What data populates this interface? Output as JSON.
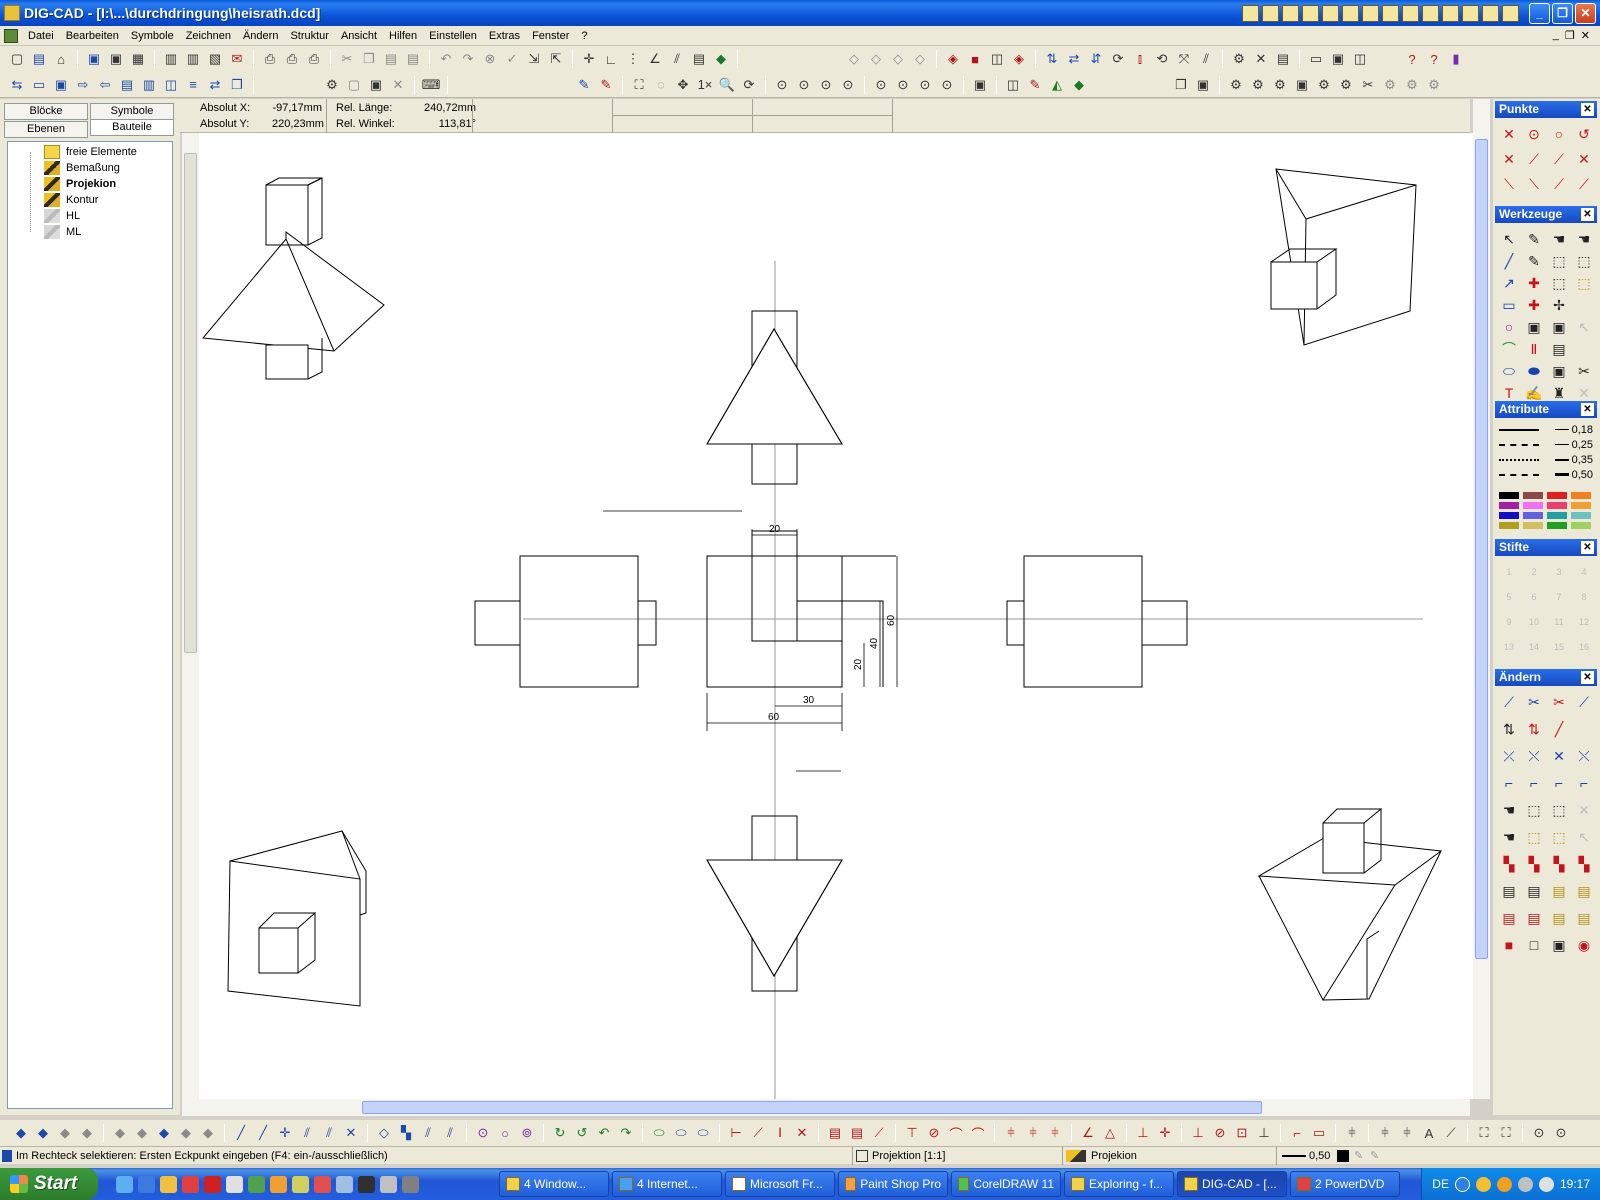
{
  "window": {
    "title": "DIG-CAD - [I:\\...\\durchdringung\\heisrath.dcd]"
  },
  "menu": [
    "Datei",
    "Bearbeiten",
    "Symbole",
    "Zeichnen",
    "Ändern",
    "Struktur",
    "Ansicht",
    "Hilfen",
    "Einstellen",
    "Extras",
    "Fenster",
    "?"
  ],
  "left_panel": {
    "tabs": [
      "Blöcke",
      "Symbole",
      "Ebenen",
      "Bauteile"
    ],
    "active_tab": "Bauteile",
    "tree": [
      {
        "label": "freie Elemente",
        "icon": "folder-icon"
      },
      {
        "label": "Bemaßung",
        "icon": "part-icon"
      },
      {
        "label": "Projekion",
        "icon": "part-icon",
        "bold": true
      },
      {
        "label": "Kontur",
        "icon": "part-icon"
      },
      {
        "label": "HL",
        "icon": "part-icon-gray"
      },
      {
        "label": "ML",
        "icon": "part-icon-gray"
      }
    ]
  },
  "coords": {
    "abs_x_label": "Absolut X:",
    "abs_x": "-97,17mm",
    "abs_y_label": "Absolut Y:",
    "abs_y": "220,23mm",
    "rel_len_label": "Rel. Länge:",
    "rel_len": "240,72mm",
    "rel_ang_label": "Rel. Winkel:",
    "rel_ang": "113,81°"
  },
  "dimensions": {
    "top_width": "20",
    "height_total": "60",
    "height_mid": "40",
    "height_low": "20",
    "width_right": "30",
    "width_total": "60"
  },
  "palettes": {
    "punkte": "Punkte",
    "werkzeuge": "Werkzeuge",
    "attribute": "Attribute",
    "stifte": "Stifte",
    "aendern": "Ändern",
    "line_widths": [
      "0,18",
      "0,25",
      "0,35",
      "0,50"
    ],
    "colors": [
      "#000000",
      "#8b4a4a",
      "#e02020",
      "#f08020",
      "#a020a0",
      "#f070f0",
      "#e84070",
      "#f0a030",
      "#1010c0",
      "#6060e0",
      "#20a0a0",
      "#70c0c0",
      "#b0a020",
      "#d0c060",
      "#20a020",
      "#a0d060"
    ],
    "pen_labels": [
      "1",
      "2",
      "3",
      "4",
      "5",
      "6",
      "7",
      "8",
      "9",
      "10",
      "11",
      "12",
      "13",
      "14",
      "15",
      "16"
    ]
  },
  "status": {
    "message": "Im Rechteck selektieren: Ersten Eckpunkt eingeben (F4: ein-/ausschließlich)",
    "view": "Projektion [1:1]",
    "layer": "Projekion",
    "line_width": "0,50"
  },
  "taskbar": {
    "start": "Start",
    "tasks": [
      "4 Window...",
      "4 Internet...",
      "Microsoft Fr...",
      "Paint Shop Pro",
      "CorelDRAW 11",
      "Exploring - f...",
      "DIG-CAD - [...",
      "2 PowerDVD"
    ],
    "active_task": "DIG-CAD - [...",
    "lang": "DE",
    "time": "19:17"
  }
}
